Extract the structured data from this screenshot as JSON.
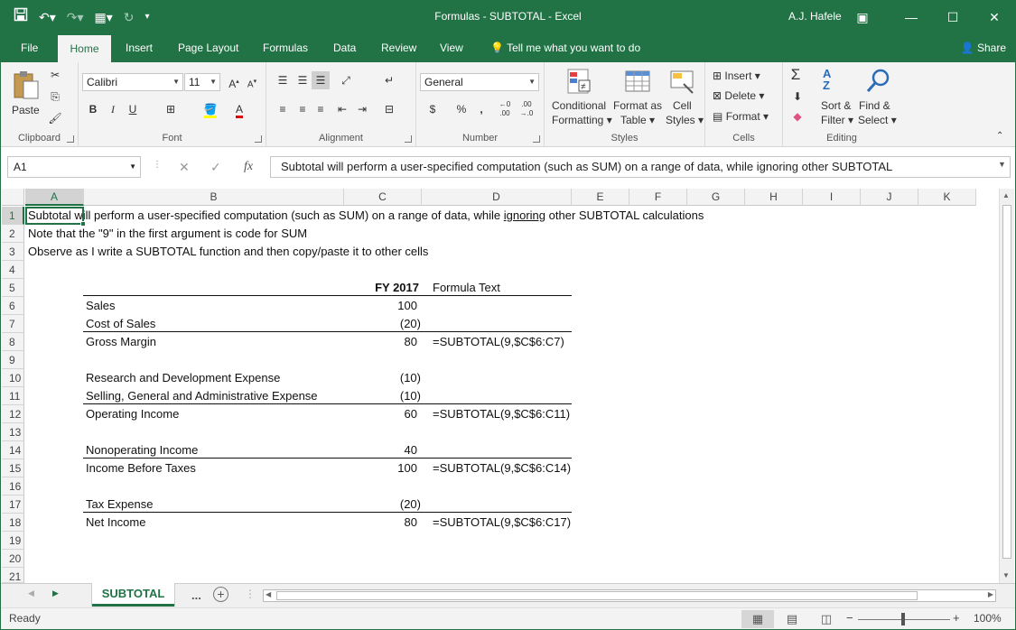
{
  "window": {
    "title": "Formulas - SUBTOTAL  -  Excel",
    "user": "A.J. Hafele",
    "icons": {
      "save": "save-icon",
      "undo": "undo-icon",
      "redo": "redo-icon"
    }
  },
  "tabs": [
    "File",
    "Home",
    "Insert",
    "Page Layout",
    "Formulas",
    "Data",
    "Review",
    "View"
  ],
  "tell_me": "Tell me what you want to do",
  "share": "Share",
  "ribbon": {
    "clipboard": {
      "label": "Clipboard",
      "paste": "Paste"
    },
    "font": {
      "label": "Font",
      "name": "Calibri",
      "size": "11",
      "bold": "B",
      "italic": "I",
      "underline": "U"
    },
    "alignment": {
      "label": "Alignment"
    },
    "number": {
      "label": "Number",
      "format": "General",
      "currency": "$",
      "percent": "%",
      "comma": ","
    },
    "styles": {
      "label": "Styles",
      "conditional": "Conditional",
      "formatting": "Formatting",
      "format_as": "Format as",
      "table": "Table",
      "cell": "Cell",
      "styles_word": "Styles"
    },
    "cells": {
      "label": "Cells",
      "insert": "Insert",
      "delete": "Delete",
      "format": "Format"
    },
    "editing": {
      "label": "Editing",
      "sort": "Sort &",
      "filter": "Filter",
      "find": "Find &",
      "select": "Select"
    }
  },
  "formula_bar": {
    "name_box": "A1",
    "fx": "fx",
    "content": "Subtotal will perform a user-specified computation (such as SUM) on a range of data, while ignoring other SUBTOTAL"
  },
  "columns": [
    "A",
    "B",
    "C",
    "D",
    "E",
    "F",
    "G",
    "H",
    "I",
    "J",
    "K"
  ],
  "rows": [
    "1",
    "2",
    "3",
    "4",
    "5",
    "6",
    "7",
    "8",
    "9",
    "10",
    "11",
    "12",
    "13",
    "14",
    "15",
    "16",
    "17",
    "18",
    "19",
    "20",
    "21"
  ],
  "cells": {
    "a1_pre": "Subtotal will perform a user-specified computation (such as SUM) on a range of data, while ",
    "a1_ignoring": "ignoring",
    "a1_post": " other SUBTOTAL calculations",
    "a2": "Note that the \"9\" in the first argument is code for SUM",
    "a3": "Observe as I write a SUBTOTAL function and then copy/paste it to other cells",
    "c5": "FY 2017",
    "d5": "Formula Text",
    "b6": "Sales",
    "c6": "100",
    "b7": "Cost of Sales",
    "c7": "(20)",
    "b8": "Gross Margin",
    "c8": "80",
    "d8": "=SUBTOTAL(9,$C$6:C7)",
    "b10": "Research and Development Expense",
    "c10": "(10)",
    "b11": "Selling, General and Administrative Expense",
    "c11": "(10)",
    "b12": "Operating Income",
    "c12": "60",
    "d12": "=SUBTOTAL(9,$C$6:C11)",
    "b14": "Nonoperating Income",
    "c14": "40",
    "b15": "Income Before Taxes",
    "c15": "100",
    "d15": "=SUBTOTAL(9,$C$6:C14)",
    "b17": "Tax Expense",
    "c17": "(20)",
    "b18": "Net Income",
    "c18": "80",
    "d18": "=SUBTOTAL(9,$C$6:C17)"
  },
  "sheet_tabs": {
    "active": "SUBTOTAL",
    "more": "..."
  },
  "status": {
    "ready": "Ready",
    "zoom": "100%"
  }
}
